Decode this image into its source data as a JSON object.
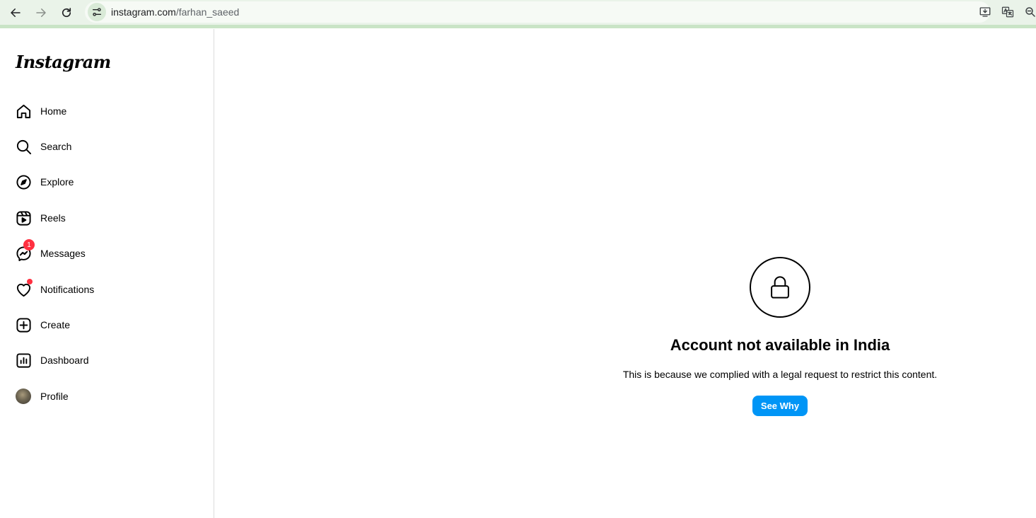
{
  "browser": {
    "url_domain": "instagram.com",
    "url_path": "/farhan_saeed"
  },
  "sidebar": {
    "logo": "Instagram",
    "items": [
      {
        "label": "Home",
        "icon": "home-icon"
      },
      {
        "label": "Search",
        "icon": "search-icon"
      },
      {
        "label": "Explore",
        "icon": "compass-icon"
      },
      {
        "label": "Reels",
        "icon": "reels-icon"
      },
      {
        "label": "Messages",
        "icon": "messenger-icon",
        "badge": "1"
      },
      {
        "label": "Notifications",
        "icon": "heart-icon"
      },
      {
        "label": "Create",
        "icon": "plus-square-icon"
      },
      {
        "label": "Dashboard",
        "icon": "dashboard-icon"
      },
      {
        "label": "Profile",
        "icon": "avatar"
      }
    ]
  },
  "main": {
    "title": "Account not available in India",
    "description": "This is because we complied with a legal request to restrict this content.",
    "button_label": "See Why"
  },
  "colors": {
    "accent": "#0095f6",
    "badge": "#ff3040",
    "chrome_bg": "#eaf3e9"
  }
}
